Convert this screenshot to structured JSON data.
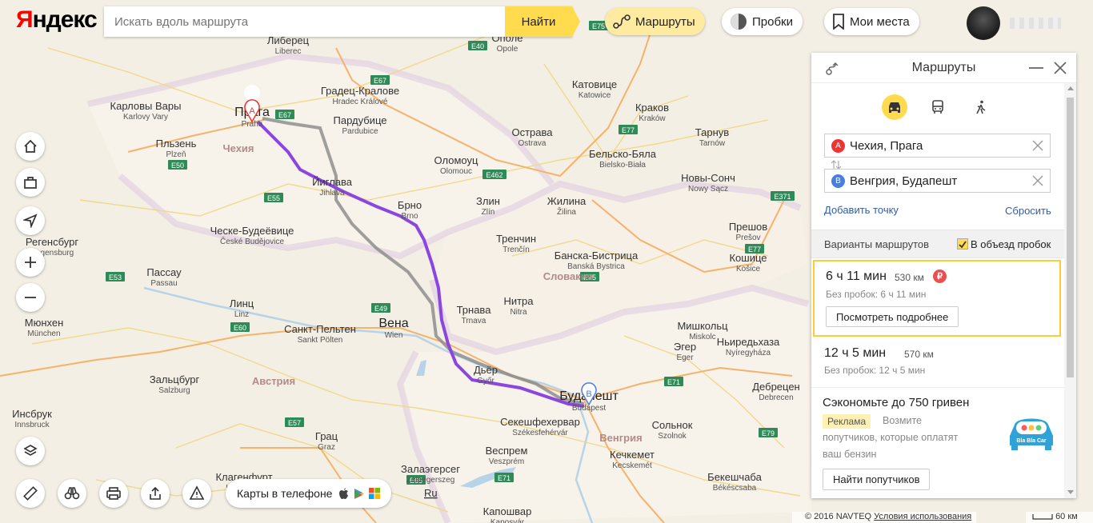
{
  "header": {
    "logo": "Яндекс",
    "search_placeholder": "Искать вдоль маршрута",
    "search_button": "Найти",
    "routes_label": "Маршруты",
    "traffic_label": "Пробки",
    "places_label": "Мои места"
  },
  "panel": {
    "title": "Маршруты",
    "point_a_marker": "A",
    "point_a": "Чехия, Прага",
    "point_b_marker": "B",
    "point_b": "Венгрия, Будапешт",
    "add_point": "Добавить точку",
    "reset": "Сбросить",
    "variants_label": "Варианты маршрутов",
    "avoid_traffic_label": "В объезд пробок",
    "avoid_traffic_checked": true,
    "routes": [
      {
        "time": "6 ч 11 мин",
        "distance": "530 км",
        "no_traffic": "Без пробок: 6 ч 11 мин",
        "toll": true
      },
      {
        "time": "12 ч 5 мин",
        "distance": "570 км",
        "no_traffic": "Без пробок: 12 ч 5 мин",
        "toll": false
      }
    ],
    "toll_symbol": "₽",
    "details_button": "Посмотреть подробнее",
    "ad": {
      "title": "Сэкономьте до 750 гривен",
      "badge": "Реклама",
      "text_line1": "Возмите",
      "text_line2": "попутчиков, которые оплатят",
      "text_line3": "ваш бензин",
      "logo_text": "Bla Bla Car",
      "button": "Найти попутчиков"
    }
  },
  "bottom": {
    "phone_label": "Карты в телефоне",
    "copyright": "© 2016 NAVTEQ",
    "terms": "Условия использования",
    "scale": "60 км"
  },
  "map": {
    "cities": [
      {
        "ru": "Либерец",
        "lat": "Liberec"
      },
      {
        "ru": "Градец-Кралове",
        "lat": "Hradec Králové"
      },
      {
        "ru": "Пардубице",
        "lat": "Pardubice"
      },
      {
        "ru": "Карловы Вары",
        "lat": "Karlovy Vary"
      },
      {
        "ru": "Прага",
        "lat": "Praha"
      },
      {
        "ru": "Пльзень",
        "lat": "Plzeň"
      },
      {
        "ru": "Йиглава",
        "lat": "Jihlava"
      },
      {
        "ru": "Брно",
        "lat": "Brno"
      },
      {
        "ru": "Ческе-Будеёвице",
        "lat": "České Budějovice"
      },
      {
        "ru": "Острава",
        "lat": "Ostrava"
      },
      {
        "ru": "Оломоуц",
        "lat": "Olomouc"
      },
      {
        "ru": "Злин",
        "lat": "Zlín"
      },
      {
        "ru": "Жилина",
        "lat": "Žilina"
      },
      {
        "ru": "Тренчин",
        "lat": "Trenčín"
      },
      {
        "ru": "Банска-Бистрица",
        "lat": "Banská Bystrica"
      },
      {
        "ru": "Трнава",
        "lat": "Trnava"
      },
      {
        "ru": "Нитра",
        "lat": "Nitra"
      },
      {
        "ru": "Вена",
        "lat": "Wien"
      },
      {
        "ru": "Санкт-Пельтен",
        "lat": "Sankt Pölten"
      },
      {
        "ru": "Линц",
        "lat": "Linz"
      },
      {
        "ru": "Дьёр",
        "lat": "Győr"
      },
      {
        "ru": "Будапешт",
        "lat": "Budapest"
      },
      {
        "ru": "Секешфехервар",
        "lat": "Székesfehérvár"
      },
      {
        "ru": "Веспрем",
        "lat": "Veszprém"
      },
      {
        "ru": "Грац",
        "lat": "Graz"
      },
      {
        "ru": "Зальцбург",
        "lat": "Salzburg"
      },
      {
        "ru": "Мюнхен",
        "lat": "München"
      },
      {
        "ru": "Инсбрук",
        "lat": "Innsbruck"
      },
      {
        "ru": "Катовице",
        "lat": "Katowice"
      },
      {
        "ru": "Краков",
        "lat": "Kraków"
      },
      {
        "ru": "Мишкольц",
        "lat": "Miskolc"
      },
      {
        "ru": "Кошице",
        "lat": "Košice"
      },
      {
        "ru": "Прешов",
        "lat": "Prešov"
      },
      {
        "ru": "Эгер",
        "lat": "Eger"
      },
      {
        "ru": "Сольнок",
        "lat": "Szolnok"
      },
      {
        "ru": "Кечкемет",
        "lat": "Kecskemét"
      },
      {
        "ru": "Ополе",
        "lat": "Opole"
      },
      {
        "ru": "Залаэгерсег",
        "lat": "Zalaegerszeg"
      },
      {
        "ru": "Дебрецен",
        "lat": "Debrecen"
      },
      {
        "ru": "Ньиредьхаза",
        "lat": "Nyíregyháza"
      },
      {
        "ru": "Бекешчаба",
        "lat": "Békéscsaba"
      },
      {
        "ru": "Капошвар",
        "lat": "Kaposvár"
      },
      {
        "ru": "Клагенфурт",
        "lat": "Klagenfurt"
      },
      {
        "ru": "Пассау",
        "lat": "Passau"
      },
      {
        "ru": "Бельско-Бяла",
        "lat": "Bielsko-Biała"
      },
      {
        "ru": "Новы-Сонч",
        "lat": "Nowy Sącz"
      },
      {
        "ru": "Тарнув",
        "lat": "Tarnów"
      },
      {
        "ru": "Регенсбург",
        "lat": "Regensburg"
      }
    ],
    "regions": [
      "Чехия",
      "Словакия",
      "Австрия",
      "Венгрия"
    ],
    "roads": [
      "E67",
      "E50",
      "E55",
      "E40",
      "E75",
      "E77",
      "E462",
      "E49",
      "E60",
      "E53",
      "E57",
      "E71",
      "E79",
      "E371",
      "E65",
      "E66"
    ],
    "marker_a": "A",
    "marker_b": "B",
    "hu_label": "Ru"
  }
}
